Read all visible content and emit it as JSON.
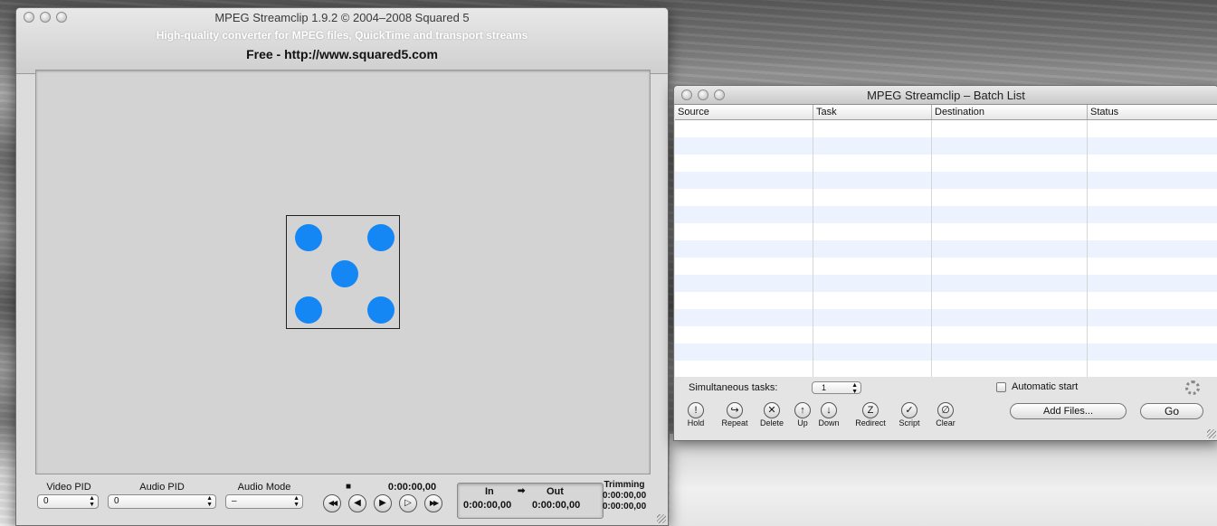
{
  "main_window": {
    "title": "MPEG Streamclip 1.9.2 © 2004–2008 Squared 5",
    "subtitle": "High-quality converter for MPEG files, QuickTime and transport streams",
    "free_text": "Free  -  http://www.squared5.com",
    "video_pid_label": "Video PID",
    "video_pid_value": "0",
    "audio_pid_label": "Audio PID",
    "audio_pid_value": "0",
    "audio_mode_label": "Audio Mode",
    "audio_mode_value": "–",
    "stop_glyph": "■",
    "timecode": "0:00:00,00",
    "in_label": "In",
    "arrow": "➡",
    "out_label": "Out",
    "in_time": "0:00:00,00",
    "out_time": "0:00:00,00",
    "trimming_label": "Trimming",
    "trimming_value_1": "0:00:00,00",
    "trimming_value_2": "0:00:00,00",
    "transport": {
      "rewind_icon": "◀◀",
      "step_back_icon": "◀",
      "play_icon": "▶",
      "step_forward_icon": "▷",
      "fast_forward_icon": "▶▶"
    },
    "dice_color": "#1487f5"
  },
  "batch_window": {
    "title": "MPEG Streamclip – Batch List",
    "columns": [
      "Source",
      "Task",
      "Destination",
      "Status"
    ],
    "simultaneous_label": "Simultaneous tasks:",
    "simultaneous_value": "1",
    "automatic_start_label": "Automatic start",
    "automatic_start_checked": false,
    "actions": [
      {
        "icon": "!",
        "label": "Hold"
      },
      {
        "icon": "↪",
        "label": "Repeat"
      },
      {
        "icon": "✕",
        "label": "Delete"
      },
      {
        "icon": "↑",
        "label": "Up"
      },
      {
        "icon": "↓",
        "label": "Down"
      },
      {
        "icon": "Z",
        "label": "Redirect"
      },
      {
        "icon": "✓",
        "label": "Script"
      },
      {
        "icon": "∅",
        "label": "Clear"
      }
    ],
    "add_files_label": "Add Files...",
    "go_label": "Go"
  }
}
